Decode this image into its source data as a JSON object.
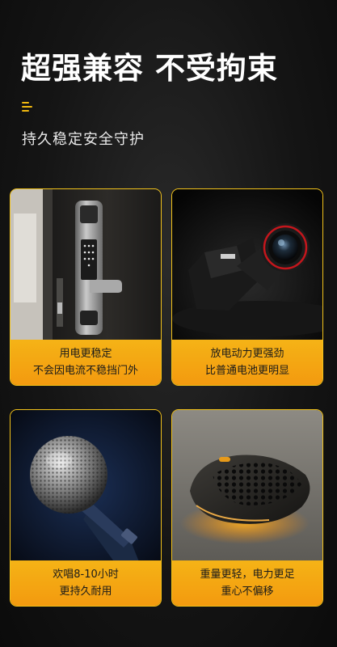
{
  "headline": "超强兼容 不受拘束",
  "subheadline": "持久稳定安全守护",
  "accent_color": "#f2b90f",
  "cards": [
    {
      "image": "smart-door-lock",
      "line1": "用电更稳定",
      "line2": "不会因电流不稳挡门外"
    },
    {
      "image": "camera",
      "line1": "放电动力更强劲",
      "line2": "比普通电池更明显"
    },
    {
      "image": "microphone",
      "line1": "欢唱8-10小时",
      "line2": "更持久耐用"
    },
    {
      "image": "gaming-mouse",
      "line1": "重量更轻，电力更足",
      "line2": "重心不偏移"
    }
  ]
}
